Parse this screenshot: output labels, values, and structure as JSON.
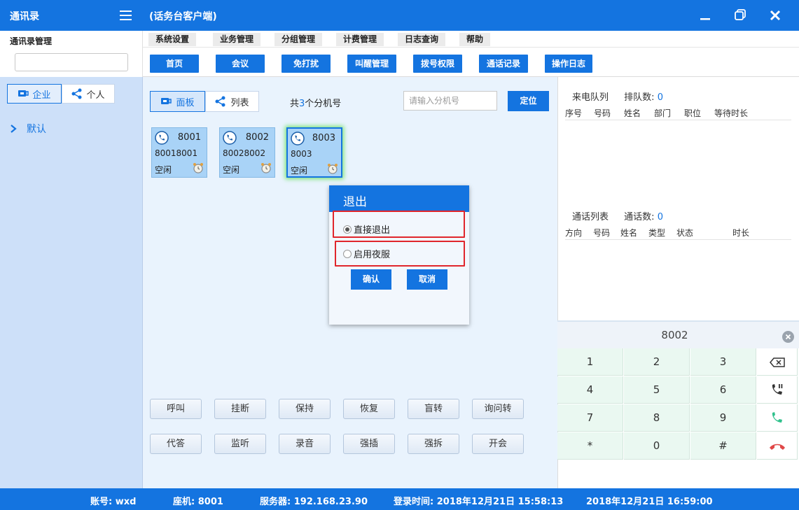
{
  "titlebar": {
    "app_name": "通讯录",
    "window_title": "(话务台客户端)"
  },
  "left": {
    "section_label": "通讯录管理",
    "search_value": "",
    "tab_enterprise": "企业",
    "tab_personal": "个人",
    "tree_default": "默认"
  },
  "menu": [
    "系统设置",
    "业务管理",
    "分组管理",
    "计费管理",
    "日志查询",
    "帮助"
  ],
  "toolbar": [
    "首页",
    "会议",
    "免打扰",
    "叫醒管理",
    "拨号权限",
    "通话记录",
    "操作日志"
  ],
  "center": {
    "tab_panel": "面板",
    "tab_list": "列表",
    "count_prefix": "共",
    "count": "3",
    "count_suffix": "个分机号",
    "search_placeholder": "请输入分机号",
    "locate": "定位",
    "extensions": [
      {
        "ext": "8001",
        "phone": "80018001",
        "status": "空闲"
      },
      {
        "ext": "8002",
        "phone": "80028002",
        "status": "空闲"
      },
      {
        "ext": "8003",
        "phone": "8003",
        "status": "空闲"
      }
    ],
    "actions_row1": [
      "呼叫",
      "挂断",
      "保持",
      "恢复",
      "盲转",
      "询问转"
    ],
    "actions_row2": [
      "代答",
      "监听",
      "录音",
      "强插",
      "强拆",
      "开会"
    ]
  },
  "dialog": {
    "title": "退出",
    "option1": "直接退出",
    "option2": "启用夜服",
    "selected": "直接退出",
    "confirm": "确认",
    "cancel": "取消"
  },
  "right": {
    "queue_label": "来电队列",
    "queue_count_label": "排队数:",
    "queue_count": "0",
    "queue_cols": [
      "序号",
      "号码",
      "姓名",
      "部门",
      "职位",
      "等待时长"
    ],
    "calls_label": "通话列表",
    "calls_count_label": "通话数:",
    "calls_count": "0",
    "calls_cols": [
      "方向",
      "号码",
      "姓名",
      "类型",
      "状态",
      "时长"
    ]
  },
  "dialpad": {
    "display": "8002",
    "keys": [
      "1",
      "2",
      "3",
      "4",
      "5",
      "6",
      "7",
      "8",
      "9",
      "*",
      "0",
      "#"
    ]
  },
  "status": {
    "account": "账号: wxd",
    "seat": "座机: 8001",
    "server": "服务器: 192.168.23.90",
    "login_time": "登录时间: 2018年12月21日 15:58:13",
    "now": "2018年12月21日 16:59:00"
  },
  "colors": {
    "primary": "#1474e0",
    "highlight_red": "#e0262c",
    "call_green": "#2fc18c",
    "hangup_red": "#e04848"
  }
}
